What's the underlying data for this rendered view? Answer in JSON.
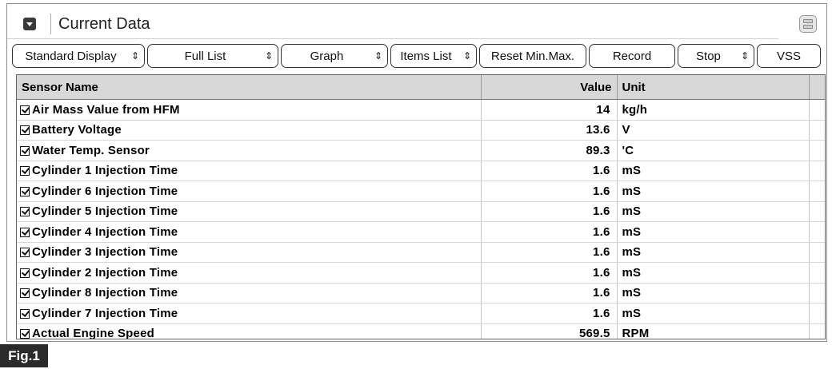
{
  "panel": {
    "title": "Current Data"
  },
  "toolbar": {
    "standard_display": "Standard Display",
    "full_list": "Full List",
    "graph": "Graph",
    "items_list": "Items List",
    "reset_minmax": "Reset Min.Max.",
    "record": "Record",
    "stop": "Stop",
    "vss": "VSS",
    "dropdown_icon": "⇕"
  },
  "table": {
    "headers": {
      "name": "Sensor Name",
      "value": "Value",
      "unit": "Unit"
    },
    "rows": [
      {
        "name": "Air Mass Value from HFM",
        "value": "14",
        "unit": "kg/h"
      },
      {
        "name": "Battery Voltage",
        "value": "13.6",
        "unit": "V"
      },
      {
        "name": "Water Temp. Sensor",
        "value": "89.3",
        "unit": "'C"
      },
      {
        "name": "Cylinder 1 Injection Time",
        "value": "1.6",
        "unit": "mS"
      },
      {
        "name": "Cylinder 6 Injection Time",
        "value": "1.6",
        "unit": "mS"
      },
      {
        "name": "Cylinder 5 Injection Time",
        "value": "1.6",
        "unit": "mS"
      },
      {
        "name": "Cylinder 4 Injection Time",
        "value": "1.6",
        "unit": "mS"
      },
      {
        "name": "Cylinder 3 Injection Time",
        "value": "1.6",
        "unit": "mS"
      },
      {
        "name": "Cylinder 2 Injection Time",
        "value": "1.6",
        "unit": "mS"
      },
      {
        "name": "Cylinder 8 Injection Time",
        "value": "1.6",
        "unit": "mS"
      },
      {
        "name": "Cylinder 7 Injection Time",
        "value": "1.6",
        "unit": "mS"
      },
      {
        "name": "Actual Engine Speed",
        "value": "569.5",
        "unit": "RPM"
      }
    ]
  },
  "figure": {
    "label": "Fig.1"
  }
}
